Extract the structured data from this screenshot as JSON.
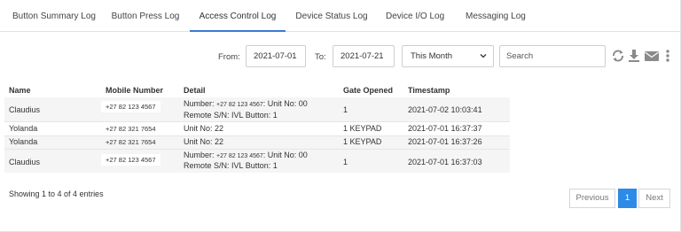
{
  "tabs": [
    {
      "label": "Button Summary Log"
    },
    {
      "label": "Button Press Log"
    },
    {
      "label": "Access Control Log"
    },
    {
      "label": "Device Status Log"
    },
    {
      "label": "Device I/O Log"
    },
    {
      "label": "Messaging Log"
    }
  ],
  "active_tab": "Access Control Log",
  "filters": {
    "from_label": "From:",
    "from_value": "2021-07-01",
    "to_label": "To:",
    "to_value": "2021-07-21",
    "range_selected": "This Month",
    "search_placeholder": "Search"
  },
  "icons": [
    "refresh-icon",
    "download-icon",
    "mail-icon",
    "more-vertical-icon"
  ],
  "table": {
    "headers": [
      "Name",
      "Mobile Number",
      "Detail",
      "Gate Opened",
      "Timestamp"
    ],
    "rows": [
      {
        "name": "Claudius",
        "mobile": "+27 82 123 4567",
        "detail_prefix": "Number:",
        "detail_mobile": "+27 82 123 4567",
        "detail_unit": ": Unit No: 00",
        "detail_line2": "Remote S/N: IVL Button: 1",
        "gate": "1",
        "timestamp": "2021-07-02 10:03:41"
      },
      {
        "name": "Yolanda",
        "mobile": "+27 82 321 7654",
        "detail_line1": "Unit No: 22",
        "gate": "1 KEYPAD",
        "timestamp": "2021-07-01 16:37:37"
      },
      {
        "name": "Yolanda",
        "mobile": "+27 82 321 7654",
        "detail_line1": "Unit No: 22",
        "gate": "1 KEYPAD",
        "timestamp": "2021-07-01 16:37:26"
      },
      {
        "name": "Claudius",
        "mobile": "+27 82 123 4567",
        "detail_prefix": "Number:",
        "detail_mobile": "+27 82 123 4567",
        "detail_unit": ": Unit No: 00",
        "detail_line2": "Remote S/N: IVL Button: 1",
        "gate": "1",
        "timestamp": "2021-07-01 16:37:03"
      }
    ]
  },
  "footer": {
    "info": "Showing 1 to 4 of 4 entries",
    "previous": "Previous",
    "page": "1",
    "next": "Next"
  },
  "colors": {
    "accent": "#2d8ae6",
    "tab_underline": "#3a7bd5",
    "row_shade": "#f5f5f5"
  }
}
